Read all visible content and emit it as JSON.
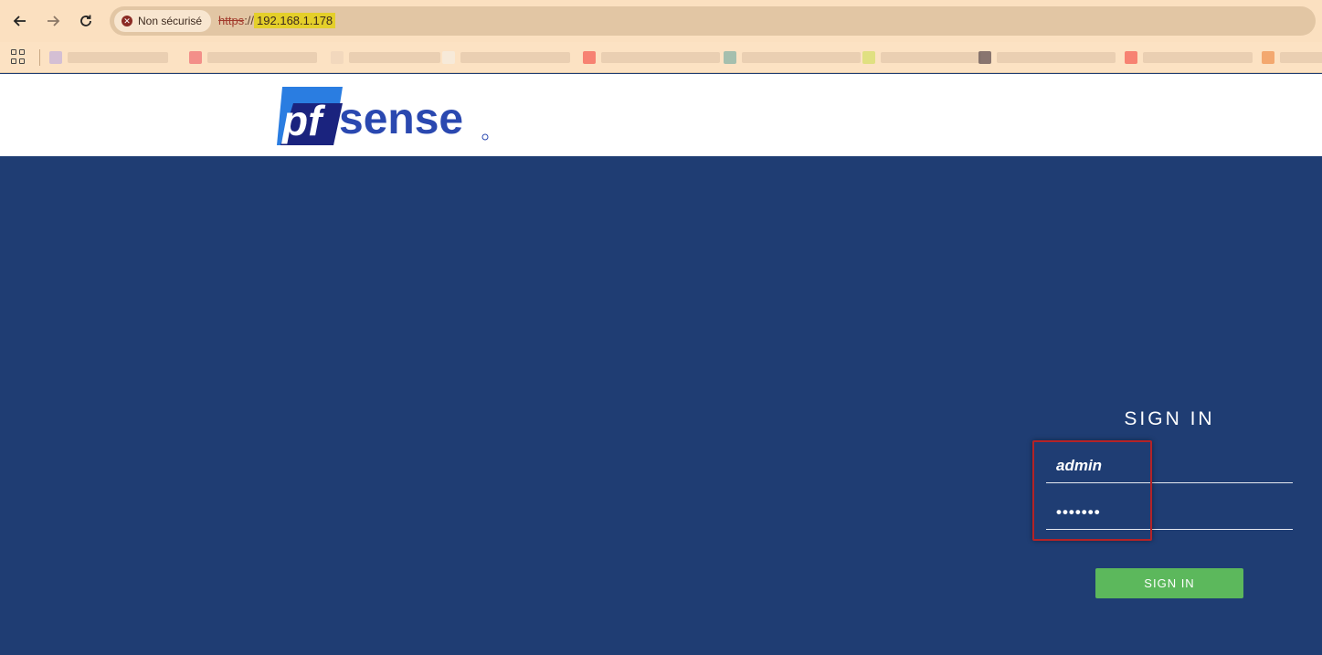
{
  "browser": {
    "security_label": "Non sécurisé",
    "url_scheme": "https",
    "url_sep": "://",
    "url_host": "192.168.1.178",
    "icons": {
      "back": "back-arrow-icon",
      "forward": "forward-arrow-icon",
      "reload": "reload-icon",
      "security": "not-secure-icon",
      "apps": "apps-grid-icon"
    }
  },
  "page": {
    "brand": "pfsense",
    "signin_title": "SIGN IN",
    "username_value": "admin",
    "password_value": "•••••••",
    "signin_button": "SIGN IN"
  },
  "colors": {
    "page_background": "#1f3d73",
    "button": "#5cb85c",
    "highlight": "#b42327",
    "logo_blue": "#2a48b0",
    "logo_dark": "#1a237e"
  }
}
